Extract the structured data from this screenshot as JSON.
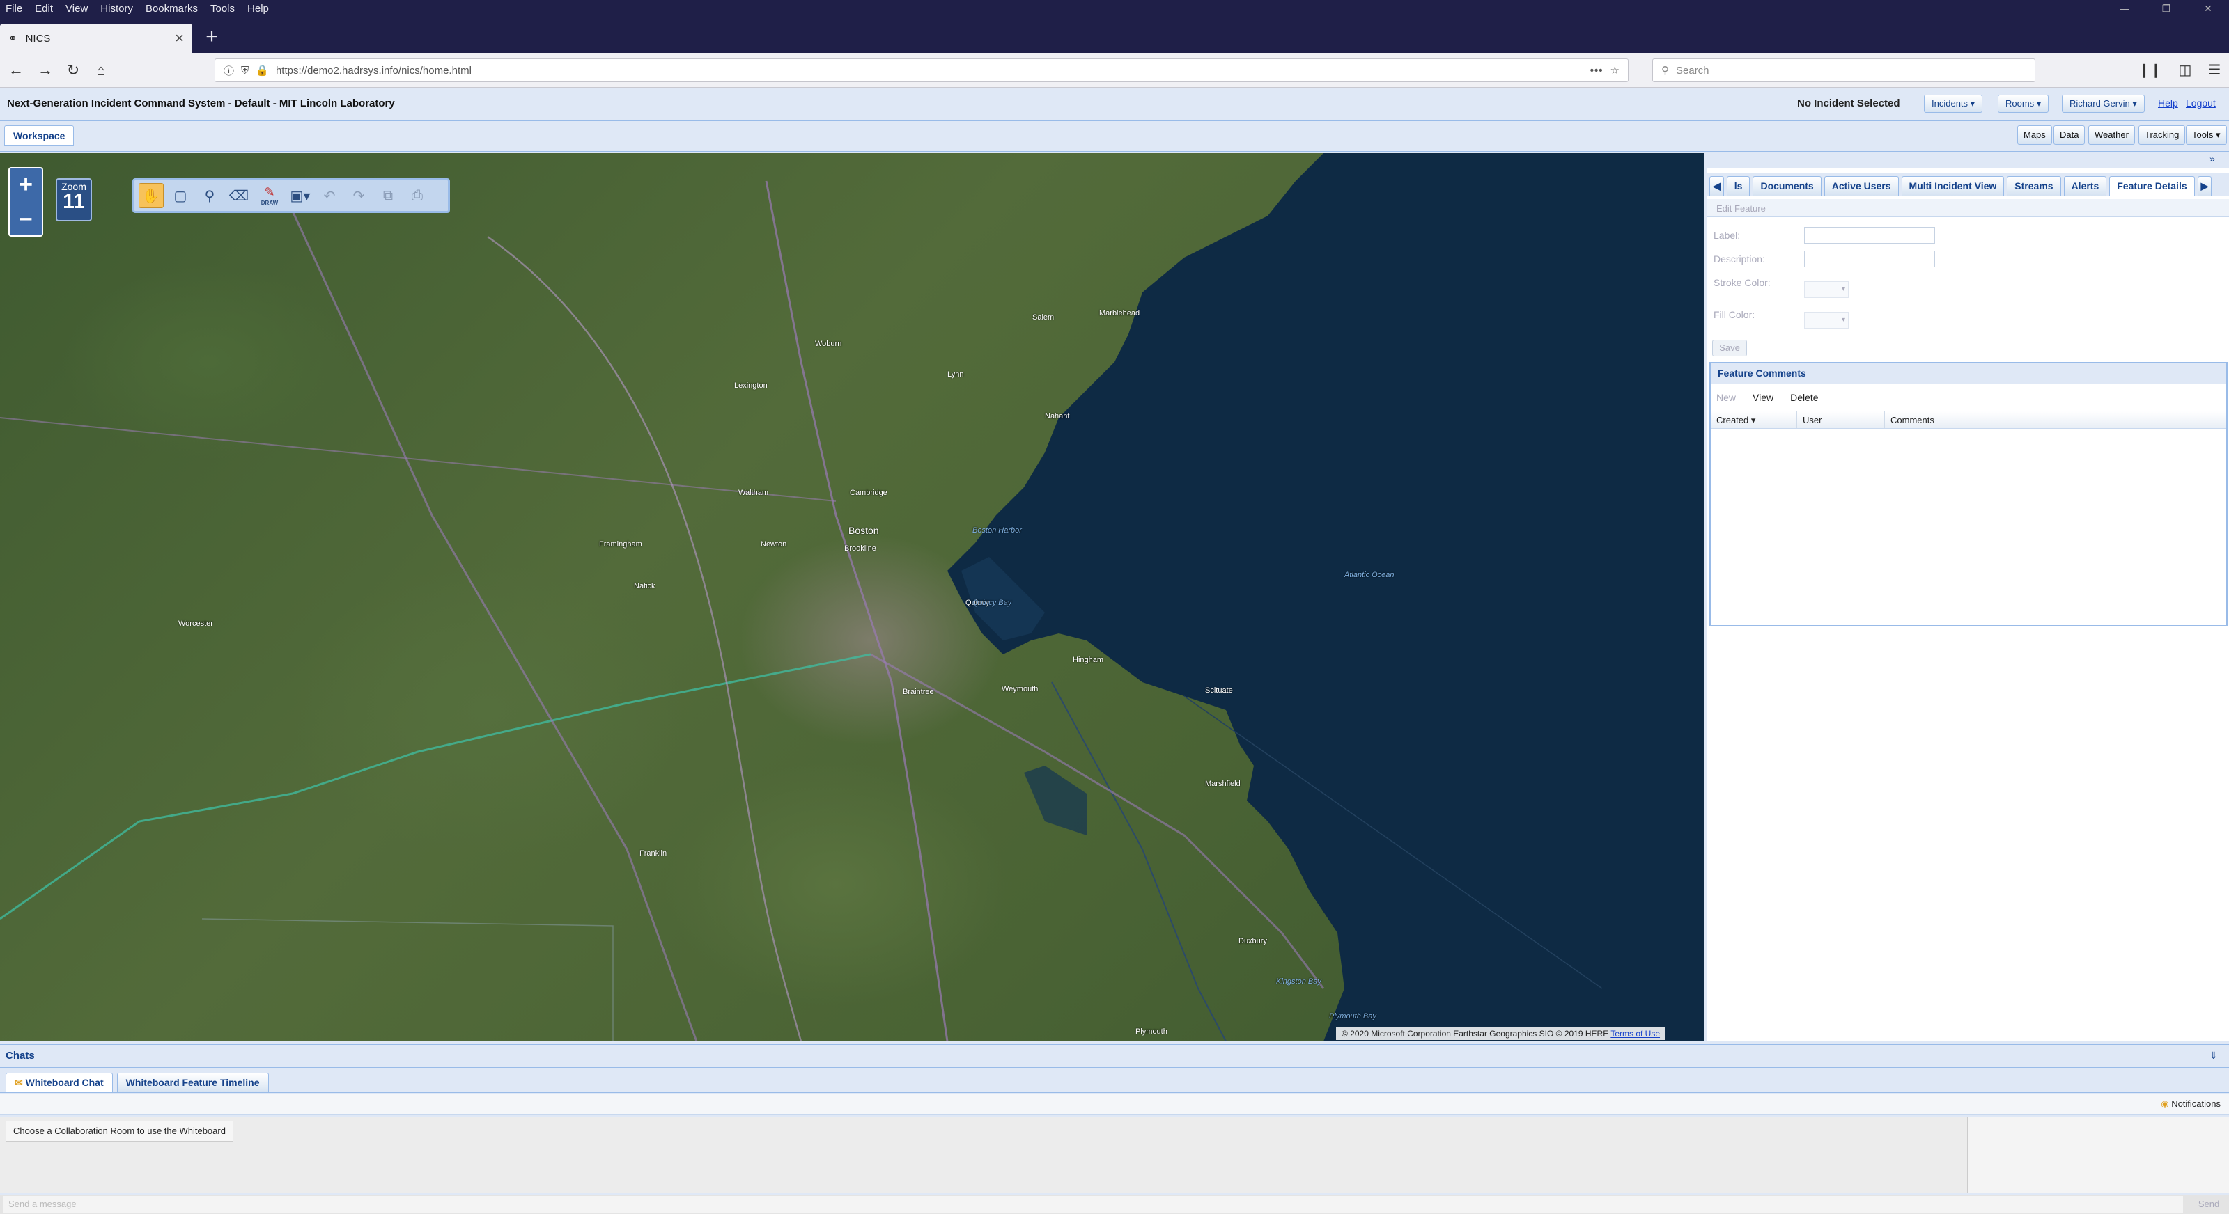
{
  "browser": {
    "menu": [
      "File",
      "Edit",
      "View",
      "History",
      "Bookmarks",
      "Tools",
      "Help"
    ],
    "tab_title": "NICS",
    "url": "https://demo2.hadrsys.info/nics/home.html",
    "search_placeholder": "Search"
  },
  "header": {
    "title": "Next-Generation Incident Command System - Default - MIT Lincoln Laboratory",
    "incident_status": "No Incident Selected",
    "incidents_label": "Incidents",
    "rooms_label": "Rooms",
    "user_label": "Richard Gervin",
    "help_label": "Help",
    "logout_label": "Logout"
  },
  "workspace": {
    "tab_label": "Workspace",
    "tools": [
      "Maps",
      "Data",
      "Weather",
      "Tracking",
      "Tools"
    ]
  },
  "map": {
    "zoom_label": "Zoom",
    "zoom_level": "11",
    "draw_label": "DRAW",
    "attribution": "© 2020 Microsoft Corporation Earthstar Geographics SIO © 2019 HERE",
    "terms_label": "Terms of Use",
    "labels": {
      "boston": "Boston",
      "cambridge": "Cambridge",
      "quincy": "Quincy",
      "brookline": "Brookline",
      "newton": "Newton",
      "waltham": "Waltham",
      "lexington": "Lexington",
      "woburn": "Woburn",
      "lynn": "Lynn",
      "salem": "Salem",
      "marblehead": "Marblehead",
      "nahant": "Nahant",
      "framingham": "Framingham",
      "natick": "Natick",
      "worcester": "Worcester",
      "hingham": "Hingham",
      "weymouth": "Weymouth",
      "braintree": "Braintree",
      "marshfield": "Marshfield",
      "scituate": "Scituate",
      "duxbury": "Duxbury",
      "plymouth": "Plymouth",
      "franklin": "Franklin",
      "atlantic": "Atlantic Ocean",
      "boston_harbor": "Boston Harbor",
      "quincy_bay": "Quincy Bay",
      "kingston_bay": "Kingston Bay",
      "cape_cod_bay": "Plymouth Bay"
    }
  },
  "right_panel": {
    "tabs": [
      "ls",
      "Documents",
      "Active Users",
      "Multi Incident View",
      "Streams",
      "Alerts",
      "Feature Details"
    ],
    "active_tab": "Feature Details",
    "edit_feature_label": "Edit Feature",
    "fields": {
      "label": "Label:",
      "description": "Description:",
      "stroke_color": "Stroke Color:",
      "fill_color": "Fill Color:"
    },
    "save_label": "Save",
    "comments_title": "Feature Comments",
    "comment_actions": [
      "New",
      "View",
      "Delete"
    ],
    "columns": [
      "Created",
      "User",
      "Comments"
    ]
  },
  "bottom": {
    "chats_label": "Chats",
    "tabs": [
      "Whiteboard Chat",
      "Whiteboard Feature Timeline"
    ],
    "notifications_label": "Notifications",
    "whiteboard_message": "Choose a Collaboration Room to use the Whiteboard",
    "send_placeholder": "Send a message",
    "send_label": "Send"
  },
  "colors": {
    "ext_blue": "#dfe8f6",
    "ext_border": "#99bbe8",
    "ext_text": "#15428b",
    "ocean": "#0e2a44",
    "land": "#4a6334"
  }
}
